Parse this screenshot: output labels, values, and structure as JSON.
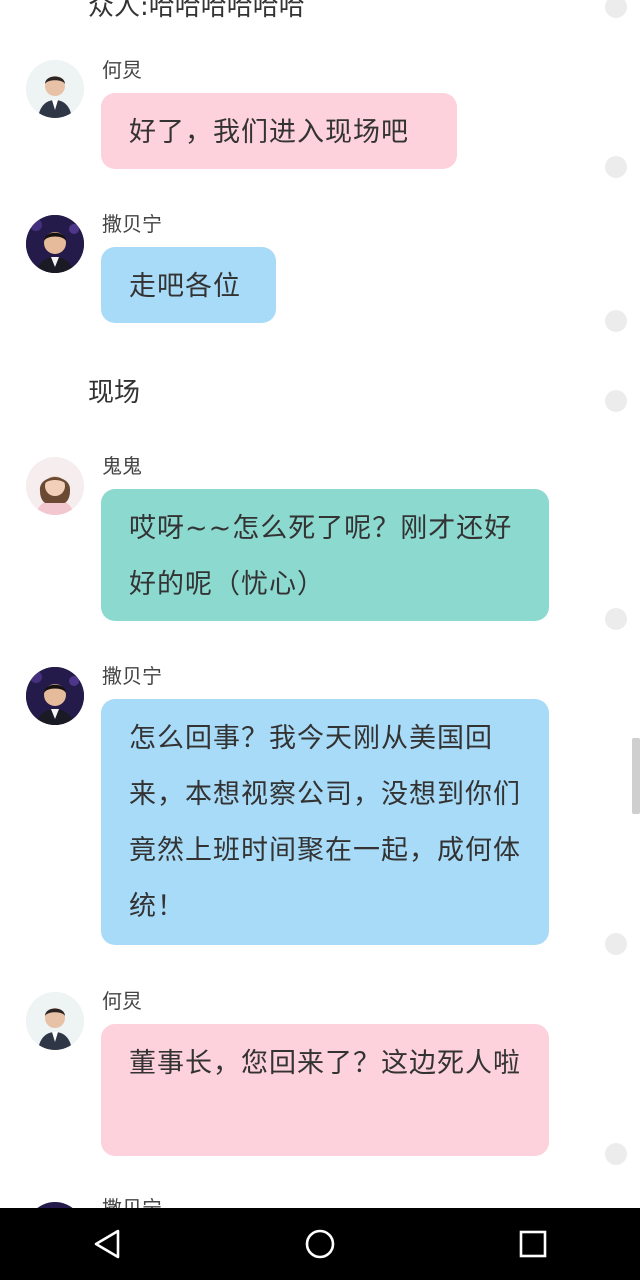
{
  "top_text": "众人:哈哈哈哈哈哈",
  "scene_label": "现场",
  "messages": [
    {
      "sender": "何炅",
      "text": "好了，我们进入现场吧",
      "color": "pink"
    },
    {
      "sender": "撒贝宁",
      "text": "走吧各位",
      "color": "blue"
    },
    {
      "sender": "鬼鬼",
      "text": "哎呀~~怎么死了呢？刚才还好好的呢（忧心）",
      "color": "teal"
    },
    {
      "sender": "撒贝宁",
      "text": "怎么回事？我今天刚从美国回来，本想视察公司，没想到你们竟然上班时间聚在一起，成何体统！",
      "color": "blue"
    },
    {
      "sender": "何炅",
      "text": "董事长，您回来了？这边死人啦",
      "color": "pink"
    },
    {
      "sender": "撒贝宁",
      "text": "",
      "color": "blue"
    }
  ],
  "colors": {
    "pink_bubble": "#fdd2dc",
    "blue_bubble": "#a8dbf8",
    "teal_bubble": "#8cd9d0",
    "nav_bar": "#000000"
  },
  "nav": {
    "back_icon": "back-triangle-icon",
    "home_icon": "home-circle-icon",
    "recents_icon": "recents-square-icon"
  }
}
